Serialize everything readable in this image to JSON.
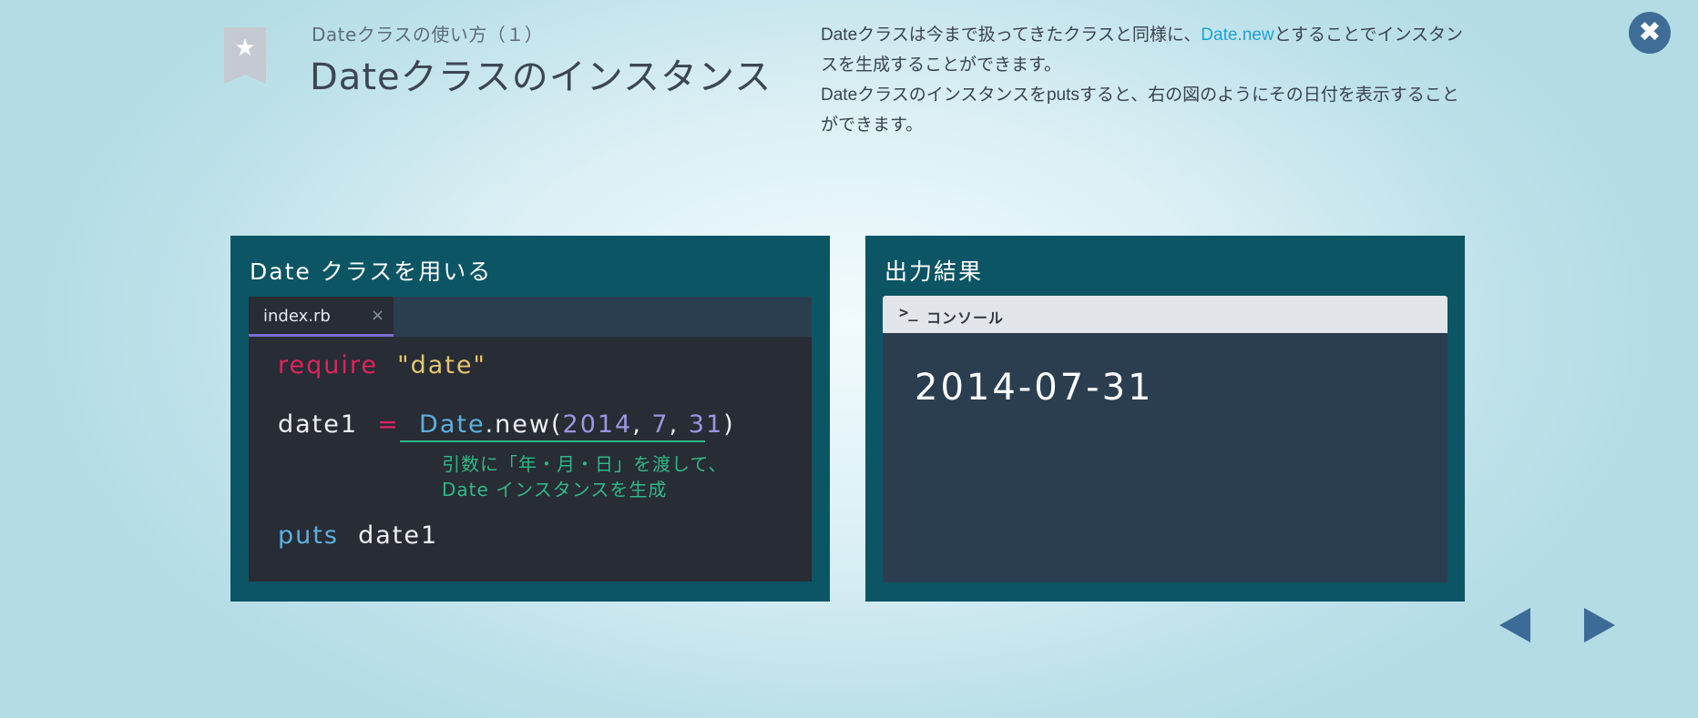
{
  "header": {
    "subtitle": "Dateクラスの使い方（１）",
    "title": "Dateクラスのインスタンス"
  },
  "description": {
    "line1_before": "Dateクラスは今まで扱ってきたクラスと同様に、",
    "line1_link": "Date.new",
    "line1_after": "とすることでインスタンスを生成することができます。",
    "line2": "Dateクラスのインスタンスをputsすると、右の図のようにその日付を表示することができます。"
  },
  "left_panel": {
    "heading": "Date クラスを用いる",
    "tab_name": "index.rb",
    "tab_close": "×",
    "code": {
      "line1": {
        "keyword": "require",
        "string": "\"date\""
      },
      "line2": {
        "var": "date1",
        "op": "=",
        "klass": "Date",
        "method": ".new(",
        "arg1": "2014",
        "sep1": ",",
        "arg2": "7",
        "sep2": ",",
        "arg3": "31",
        "close": ")"
      },
      "line3": {
        "keyword": "puts",
        "arg": "date1"
      }
    },
    "annotation_line1": "引数に「年・月・日」を渡して、",
    "annotation_line2": "Date インスタンスを生成"
  },
  "right_panel": {
    "heading": "出力結果",
    "console_label": "コンソール",
    "output": "2014-07-31"
  },
  "colors": {
    "panel": "#0b5564",
    "editor": "#272c35",
    "console": "#2b3e4f",
    "keyword_red": "#e0245e",
    "string_yellow": "#e5c66e",
    "class_blue": "#5db0de",
    "number_purple": "#9f93e0",
    "annotation_green": "#31b884",
    "nav_blue": "#3d6b98",
    "link_blue": "#1aa3d6"
  },
  "icons": {
    "bookmark": "bookmark-star-icon",
    "close": "close-icon",
    "prompt": "terminal-prompt-icon",
    "prev": "triangle-left-icon",
    "next": "triangle-right-icon"
  }
}
